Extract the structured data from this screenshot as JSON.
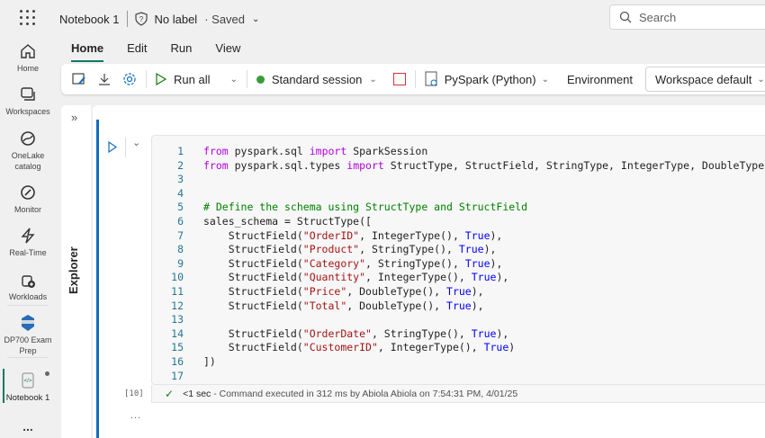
{
  "header": {
    "notebook_title": "Notebook 1",
    "label": "No label",
    "saved": "· Saved",
    "search_placeholder": "Search"
  },
  "rail": [
    {
      "label": "Home"
    },
    {
      "label": "Workspaces"
    },
    {
      "label": "OneLake catalog"
    },
    {
      "label": "Monitor"
    },
    {
      "label": "Real-Time"
    },
    {
      "label": "Workloads"
    },
    {
      "label": "DP700 Exam Prep"
    },
    {
      "label": "Notebook 1"
    }
  ],
  "rail_more": "...",
  "tabs": [
    {
      "label": "Home"
    },
    {
      "label": "Edit"
    },
    {
      "label": "Run"
    },
    {
      "label": "View"
    }
  ],
  "toolbar": {
    "run_all": "Run all",
    "session": "Standard session",
    "language": "PySpark (Python)",
    "environment_label": "Environment",
    "environment_value": "Workspace default"
  },
  "explorer": {
    "label": "Explorer"
  },
  "cell": {
    "execution_count": "[10]",
    "status_duration": "<1 sec",
    "status_text": " - Command executed in 312 ms by Abiola Abiola on 7:54:31 PM, 4/01/25",
    "more": "...",
    "lines": [
      [
        [
          "kw",
          "from"
        ],
        [
          "tx",
          " pyspark.sql "
        ],
        [
          "kw",
          "import"
        ],
        [
          "tx",
          " SparkSession"
        ]
      ],
      [
        [
          "kw",
          "from"
        ],
        [
          "tx",
          " pyspark.sql.types "
        ],
        [
          "kw",
          "import"
        ],
        [
          "tx",
          " StructType, StructField, StringType, IntegerType, DoubleType"
        ]
      ],
      [],
      [],
      [
        [
          "cm",
          "# Define the schema using StructType and StructField"
        ]
      ],
      [
        [
          "tx",
          "sales_schema = StructType(["
        ]
      ],
      [
        [
          "tx",
          "    StructField("
        ],
        [
          "str",
          "\"OrderID\""
        ],
        [
          "tx",
          ", IntegerType(), "
        ],
        [
          "bool",
          "True"
        ],
        [
          "tx",
          "),"
        ]
      ],
      [
        [
          "tx",
          "    StructField("
        ],
        [
          "str",
          "\"Product\""
        ],
        [
          "tx",
          ", StringType(), "
        ],
        [
          "bool",
          "True"
        ],
        [
          "tx",
          "),"
        ]
      ],
      [
        [
          "tx",
          "    StructField("
        ],
        [
          "str",
          "\"Category\""
        ],
        [
          "tx",
          ", StringType(), "
        ],
        [
          "bool",
          "True"
        ],
        [
          "tx",
          "),"
        ]
      ],
      [
        [
          "tx",
          "    StructField("
        ],
        [
          "str",
          "\"Quantity\""
        ],
        [
          "tx",
          ", IntegerType(), "
        ],
        [
          "bool",
          "True"
        ],
        [
          "tx",
          "),"
        ]
      ],
      [
        [
          "tx",
          "    StructField("
        ],
        [
          "str",
          "\"Price\""
        ],
        [
          "tx",
          ", DoubleType(), "
        ],
        [
          "bool",
          "True"
        ],
        [
          "tx",
          "),"
        ]
      ],
      [
        [
          "tx",
          "    StructField("
        ],
        [
          "str",
          "\"Total\""
        ],
        [
          "tx",
          ", DoubleType(), "
        ],
        [
          "bool",
          "True"
        ],
        [
          "tx",
          "),"
        ]
      ],
      [],
      [
        [
          "tx",
          "    StructField("
        ],
        [
          "str",
          "\"OrderDate\""
        ],
        [
          "tx",
          ", StringType(), "
        ],
        [
          "bool",
          "True"
        ],
        [
          "tx",
          "),"
        ]
      ],
      [
        [
          "tx",
          "    StructField("
        ],
        [
          "str",
          "\"CustomerID\""
        ],
        [
          "tx",
          ", IntegerType(), "
        ],
        [
          "bool",
          "True"
        ],
        [
          "tx",
          ")"
        ]
      ],
      [
        [
          "tx",
          "])"
        ]
      ],
      []
    ]
  }
}
